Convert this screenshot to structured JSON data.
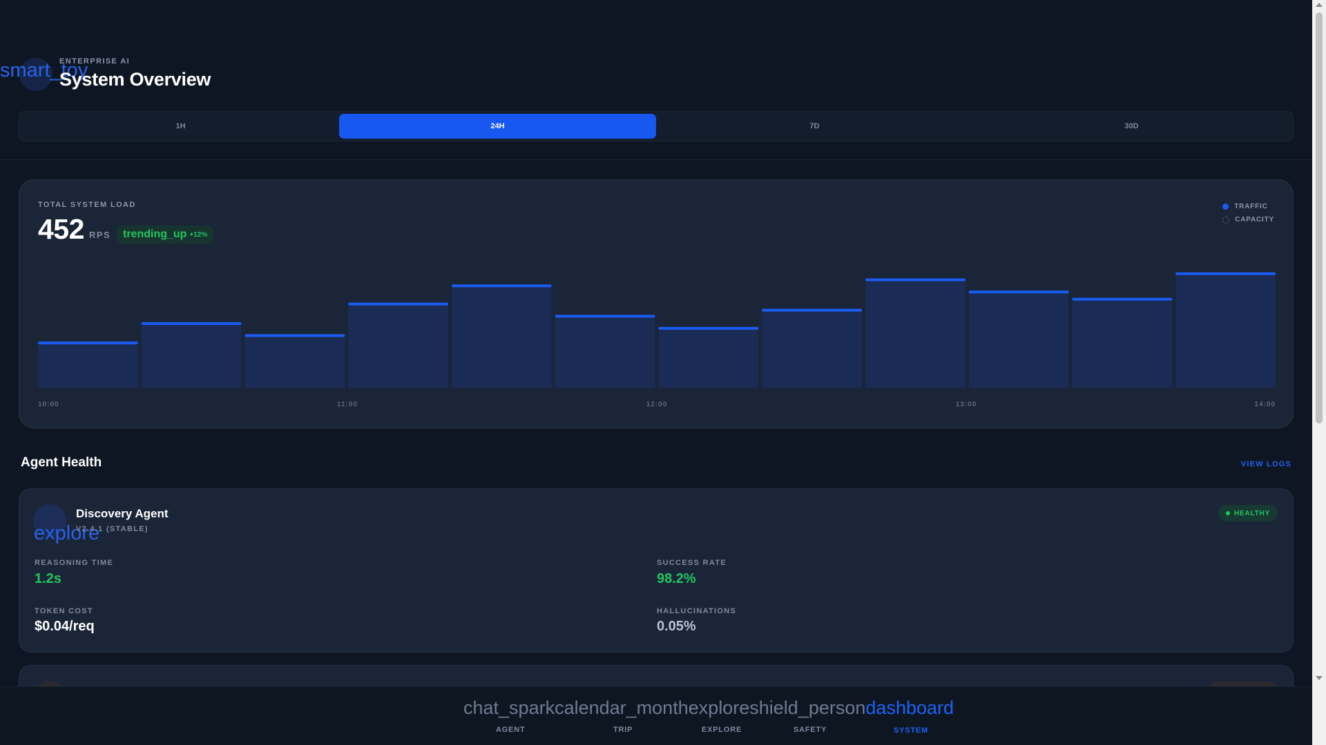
{
  "header": {
    "logo_icon": "smart_toy",
    "eyebrow": "ENTERPRISE AI",
    "title": "System Overview",
    "time_ranges": [
      "1H",
      "24H",
      "7D",
      "30D"
    ],
    "active_range": "24H"
  },
  "load": {
    "label": "TOTAL SYSTEM LOAD",
    "value": "452",
    "unit": "RPS",
    "trend_icon": "trending_up",
    "trend_value": "+12%",
    "legend": [
      {
        "label": "TRAFFIC",
        "style": "solid",
        "color": "#1a5cf2"
      },
      {
        "label": "CAPACITY",
        "style": "dashed",
        "color": "#5f6c85"
      }
    ]
  },
  "chart_data": {
    "type": "bar",
    "x_ticks": [
      "10:00",
      "11:00",
      "12:00",
      "13:00",
      "14:00"
    ],
    "values": [
      0.38,
      0.54,
      0.44,
      0.7,
      0.85,
      0.6,
      0.5,
      0.65,
      0.9,
      0.8,
      0.74,
      0.95
    ],
    "ylim": [
      0,
      1
    ],
    "grid": false,
    "colors": {
      "bar_fill": "#1a2b55",
      "bar_cap": "#1a5cf2"
    }
  },
  "agents": {
    "section_title": "Agent Health",
    "view_logs": "VIEW LOGS",
    "items": [
      {
        "icon": "explore",
        "name": "Discovery Agent",
        "version": "V2.4.1 (STABLE)",
        "status": "HEALTHY",
        "metrics": [
          {
            "label": "REASONING TIME",
            "value": "1.2s",
            "color": "#22c55e"
          },
          {
            "label": "SUCCESS RATE",
            "value": "98.2%",
            "color": "#22c55e"
          },
          {
            "label": "TOKEN COST",
            "value": "$0.04/req",
            "color": "#ffffff"
          },
          {
            "label": "HALLUCINATIONS",
            "value": "0.05%",
            "color": "#b8c2d3"
          }
        ]
      }
    ]
  },
  "nav": {
    "items": [
      {
        "icon": "chat_spark",
        "label": "AGENT"
      },
      {
        "icon": "calendar_month",
        "label": "TRIP"
      },
      {
        "icon": "explore",
        "label": "EXPLORE"
      },
      {
        "icon": "shield_person",
        "label": "SAFETY"
      },
      {
        "icon": "dashboard",
        "label": "SYSTEM"
      }
    ],
    "active": "SYSTEM"
  },
  "colors": {
    "background": "#0f1623",
    "card": "#1b2538",
    "accent": "#1658f0",
    "success": "#22c55e"
  }
}
